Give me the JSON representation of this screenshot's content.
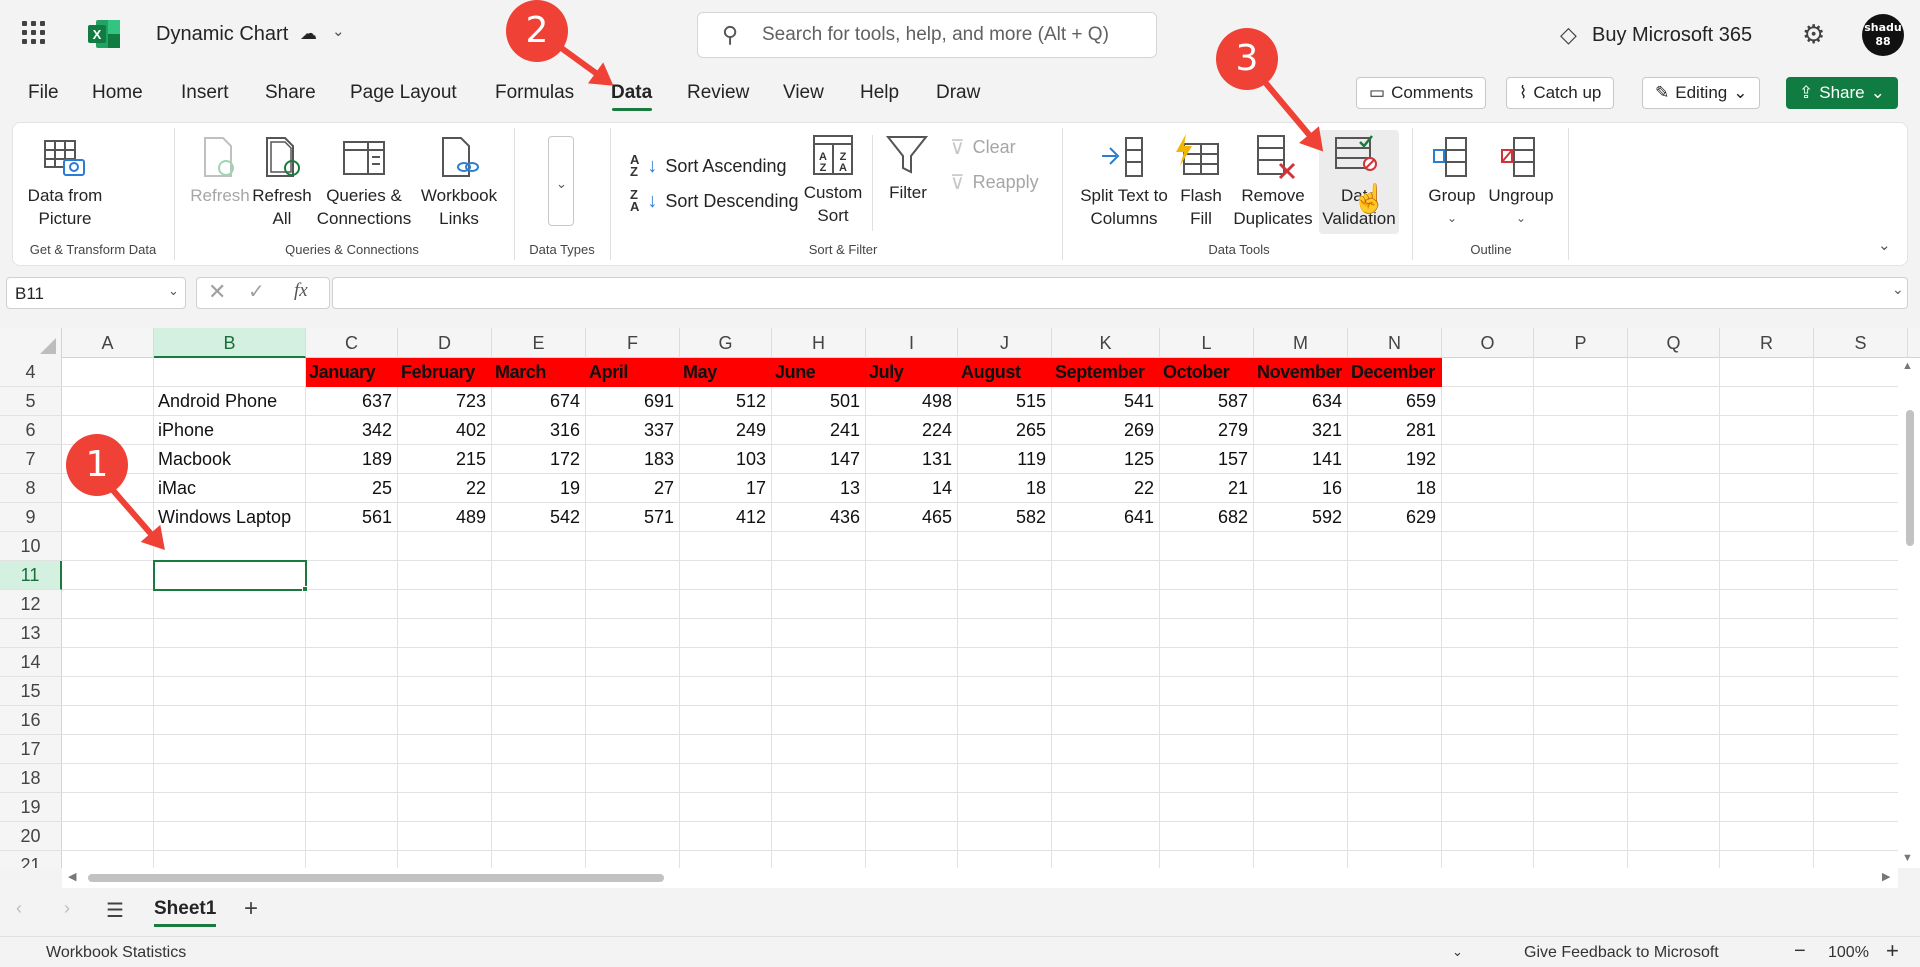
{
  "titlebar": {
    "doc_title": "Dynamic Chart",
    "search_placeholder": "Search for tools, help, and more (Alt + Q)",
    "buy_label": "Buy Microsoft 365",
    "avatar_text": "shadu 88"
  },
  "menu": {
    "tabs": [
      "File",
      "Home",
      "Insert",
      "Share",
      "Page Layout",
      "Formulas",
      "Data",
      "Review",
      "View",
      "Help",
      "Draw"
    ],
    "active": "Data",
    "comments": "Comments",
    "catch_up": "Catch up",
    "editing": "Editing",
    "share": "Share"
  },
  "ribbon": {
    "get_transform": {
      "data_from_picture": [
        "Data from",
        "Picture"
      ],
      "group_label": "Get & Transform Data"
    },
    "queries": {
      "refresh": "Refresh",
      "refresh_all": [
        "Refresh",
        "All"
      ],
      "queries_connections": [
        "Queries &",
        "Connections"
      ],
      "workbook_links": [
        "Workbook",
        "Links"
      ],
      "group_label": "Queries & Connections"
    },
    "data_types": {
      "group_label": "Data Types"
    },
    "sort_filter": {
      "sort_ascending": "Sort Ascending",
      "sort_descending": "Sort Descending",
      "custom_sort": [
        "Custom",
        "Sort"
      ],
      "filter": "Filter",
      "clear": "Clear",
      "reapply": "Reapply",
      "group_label": "Sort & Filter"
    },
    "data_tools": {
      "split_text": [
        "Split Text to",
        "Columns"
      ],
      "flash_fill": [
        "Flash",
        "Fill"
      ],
      "remove_duplicates": [
        "Remove",
        "Duplicates"
      ],
      "data_validation": [
        "Data",
        "Validation"
      ],
      "group_label": "Data Tools"
    },
    "outline": {
      "group": "Group",
      "ungroup": "Ungroup",
      "group_label": "Outline"
    }
  },
  "formula_bar": {
    "name_box": "B11",
    "fx": "fx",
    "formula": ""
  },
  "sheet": {
    "columns": [
      "A",
      "B",
      "C",
      "D",
      "E",
      "F",
      "G",
      "H",
      "I",
      "J",
      "K",
      "L",
      "M",
      "N",
      "O",
      "P",
      "Q",
      "R",
      "S"
    ],
    "rows": [
      "4",
      "5",
      "6",
      "7",
      "8",
      "9",
      "10",
      "11",
      "12",
      "13",
      "14",
      "15",
      "16",
      "17",
      "18",
      "19",
      "20",
      "21"
    ],
    "selected_column": "B",
    "selected_row": "11",
    "month_headers": [
      "January",
      "February",
      "March",
      "April",
      "May",
      "June",
      "July",
      "August",
      "September",
      "October",
      "November",
      "December"
    ],
    "data_rows": [
      {
        "label": "Android Phone",
        "values": [
          637,
          723,
          674,
          691,
          512,
          501,
          498,
          515,
          541,
          587,
          634,
          659
        ]
      },
      {
        "label": "iPhone",
        "values": [
          342,
          402,
          316,
          337,
          249,
          241,
          224,
          265,
          269,
          279,
          321,
          281
        ]
      },
      {
        "label": "Macbook",
        "values": [
          189,
          215,
          172,
          183,
          103,
          147,
          131,
          119,
          125,
          157,
          141,
          192
        ]
      },
      {
        "label": "iMac",
        "values": [
          25,
          22,
          19,
          27,
          17,
          13,
          14,
          18,
          22,
          21,
          16,
          18
        ]
      },
      {
        "label": "Windows Laptop",
        "values": [
          561,
          489,
          542,
          571,
          412,
          436,
          465,
          582,
          641,
          682,
          592,
          629
        ]
      }
    ],
    "header_fill_color": "#ff0000"
  },
  "sheet_tabs": {
    "active": "Sheet1"
  },
  "status": {
    "workbook_statistics": "Workbook Statistics",
    "feedback": "Give Feedback to Microsoft",
    "zoom": "100%"
  },
  "callouts": [
    "1",
    "2",
    "3"
  ]
}
